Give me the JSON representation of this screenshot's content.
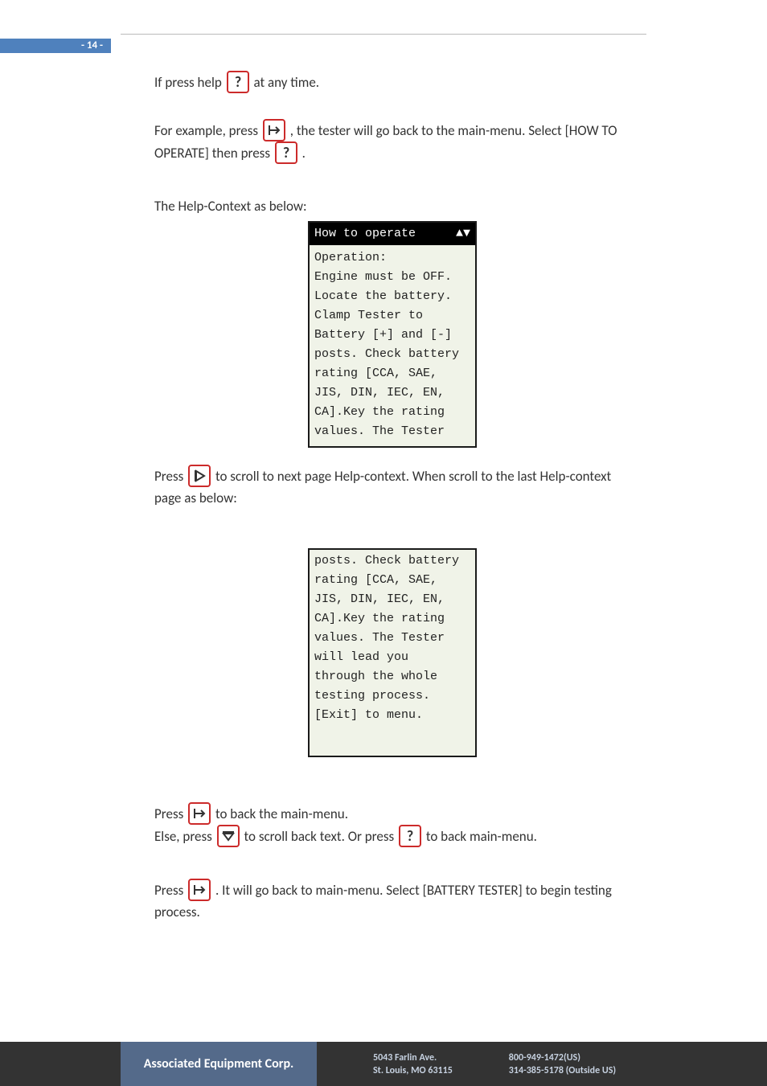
{
  "page_number": "- 14 -",
  "para1_pre": "If press help ",
  "para1_post": " at any time.",
  "para2a": "For example, press ",
  "para2b": ", the tester will go back to the main-menu. Select [HOW TO OPERATE] then press ",
  "para2c": ".",
  "para3": "The Help-Context as below:",
  "lcd1_title": "How to operate",
  "lcd1_arrows": "▲▼",
  "lcd1_lines": [
    "Operation:",
    "Engine must be OFF.",
    "Locate the battery.",
    "Clamp Tester to",
    "Battery [+] and [-]",
    "posts. Check battery",
    "rating [CCA, SAE,",
    "JIS, DIN, IEC, EN,",
    "CA].Key the rating",
    "values. The Tester"
  ],
  "para4a": "Press ",
  "para4b": " to scroll to next page Help-context. When scroll to the last Help-context page as below:",
  "lcd2_lines": [
    "posts. Check battery",
    "rating [CCA, SAE,",
    "JIS, DIN, IEC, EN,",
    "CA].Key the rating",
    "values. The Tester",
    "will lead you",
    "through the whole",
    "testing process.",
    "",
    "[Exit] to menu."
  ],
  "para5a": "Press ",
  "para5b": " to back the main-menu.",
  "para5c": "Else, press ",
  "para5d": " to scroll back text. Or press ",
  "para5e": " to back main-menu.",
  "para6a": "Press ",
  "para6b": ". It will go back to main-menu. Select [BATTERY TESTER] to begin testing process.",
  "footer_company": "Associated Equipment Corp.",
  "footer_addr1": "5043 Farlin Ave.",
  "footer_addr2": "St. Louis, MO 63115",
  "footer_ph1": "800-949-1472(US)",
  "footer_ph2": "314-385-5178 (Outside US)"
}
